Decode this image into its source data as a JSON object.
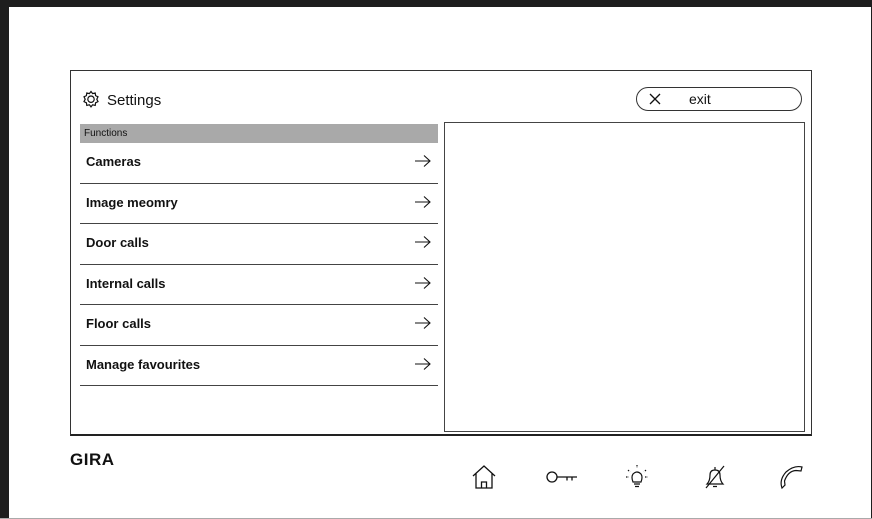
{
  "header": {
    "title": "Settings",
    "exit_label": "exit"
  },
  "functions_header": "Functions",
  "menu": {
    "items": [
      {
        "label": "Cameras"
      },
      {
        "label": "Image meomry"
      },
      {
        "label": "Door calls"
      },
      {
        "label": "Internal calls"
      },
      {
        "label": "Floor calls"
      },
      {
        "label": "Manage favourites"
      }
    ]
  },
  "brand": {
    "logo": "GIRA"
  },
  "bottom_bar": {
    "icons": [
      "home-icon",
      "key-icon",
      "light-icon",
      "bell-muted-icon",
      "phone-icon"
    ]
  },
  "colors": {
    "header_bg": "#a9a9a9",
    "frame": "#1e1e1e",
    "line": "#444444"
  }
}
